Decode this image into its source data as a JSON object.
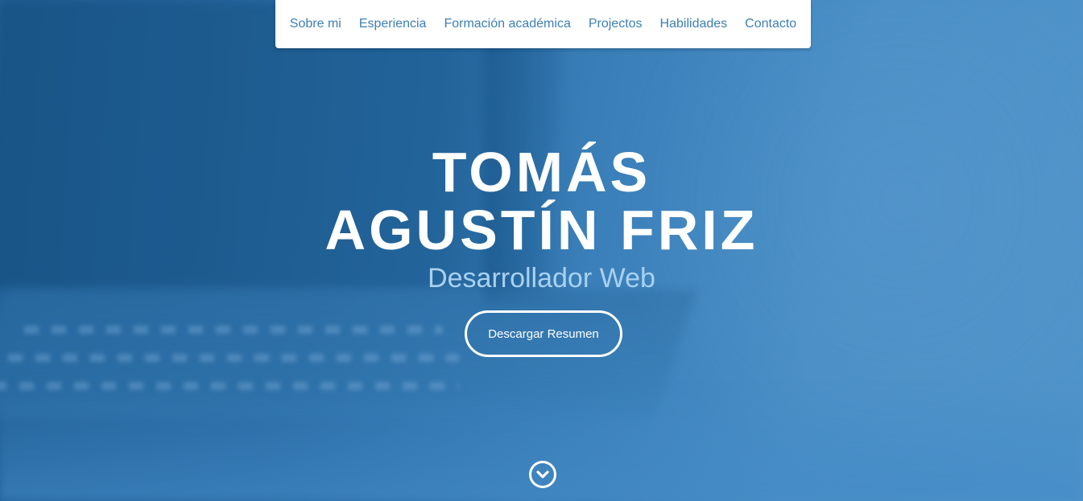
{
  "nav": {
    "items": [
      {
        "label": "Sobre mi"
      },
      {
        "label": "Esperiencia"
      },
      {
        "label": "Formación académica"
      },
      {
        "label": "Projectos"
      },
      {
        "label": "Habilidades"
      },
      {
        "label": "Contacto"
      }
    ]
  },
  "hero": {
    "name_line1": "TOMÁS",
    "name_line2": "AGUSTÍN FRIZ",
    "subtitle": "Desarrollador Web",
    "download_button": "Descargar Resumen",
    "scroll_icon": "chevron-down-icon"
  },
  "colors": {
    "background": "#3f84bd",
    "nav_link": "#3d7fb5",
    "subtitle": "#a9d1f2"
  }
}
